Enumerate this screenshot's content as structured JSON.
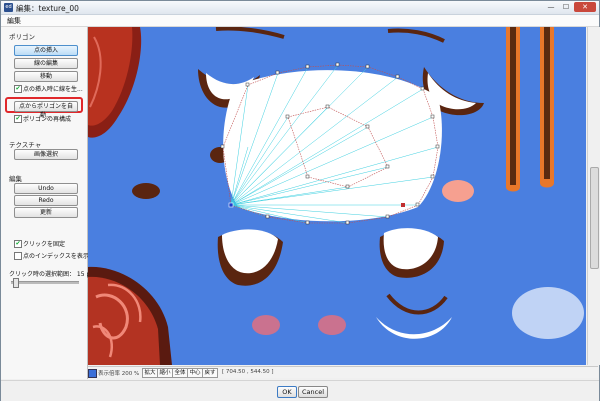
{
  "window": {
    "title": "編集：texture_00",
    "app_icon": "app-icon",
    "min_symbol": "—",
    "max_symbol": "☐",
    "close_symbol": "✕"
  },
  "menu": {
    "edit": "編集"
  },
  "panel": {
    "polygon_header": "ポリゴン",
    "add_point": "点の挿入",
    "edit_lines": "線の編集",
    "move": "移動",
    "auto_line_option": "点の挿入時に線を生...",
    "auto_polygon_from_points": "点からポリゴンを自動...",
    "rebuild_polygon": "ポリゴンの再構成",
    "texture_header": "テクスチャ",
    "select_image": "画像選択",
    "edit_header": "編集",
    "undo": "Undo",
    "redo": "Redo",
    "update": "更新",
    "fix_click": "クリックを固定",
    "show_point_index": "点のインデックスを表示",
    "click_range_label": "クリック時の選択範囲：  15 pi..."
  },
  "status": {
    "display_ratio": "表示倍率  200 %",
    "zoom_in": "拡大",
    "zoom_out": "縮小",
    "fit_all": "全体",
    "center": "中心",
    "reset": "戻す",
    "coords": "[ 704.50 , 544.50 ]"
  },
  "dialog": {
    "ok": "OK",
    "cancel": "Cancel"
  },
  "colors": {
    "canvas_bg": "#4a7fe0",
    "highlight": "#e0282b",
    "accent_button": "#bcdcf6"
  }
}
